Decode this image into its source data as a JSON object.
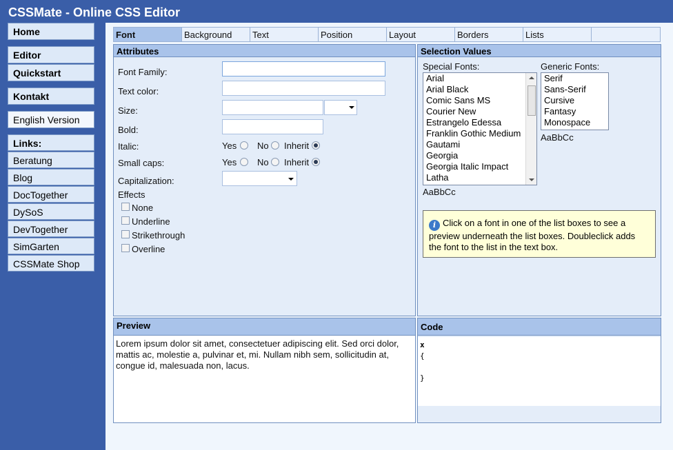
{
  "app": {
    "title": "CSSMate - Online CSS Editor"
  },
  "sidebar": {
    "items": [
      {
        "label": "Home"
      },
      {
        "label": "Editor"
      },
      {
        "label": "Quickstart"
      },
      {
        "label": "Kontakt"
      },
      {
        "label": "English Version"
      },
      {
        "label": "Links:"
      },
      {
        "label": "Beratung"
      },
      {
        "label": "Blog"
      },
      {
        "label": "DocTogether"
      },
      {
        "label": "DySoS"
      },
      {
        "label": "DevTogether"
      },
      {
        "label": "SimGarten"
      },
      {
        "label": "CSSMate Shop"
      }
    ]
  },
  "tabs": [
    {
      "label": "Font",
      "active": true
    },
    {
      "label": "Background"
    },
    {
      "label": "Text"
    },
    {
      "label": "Position"
    },
    {
      "label": "Layout"
    },
    {
      "label": "Borders"
    },
    {
      "label": "Lists"
    }
  ],
  "attributes": {
    "heading": "Attributes",
    "font_family_label": "Font Family:",
    "font_family_value": "",
    "text_color_label": "Text color:",
    "text_color_value": "",
    "size_label": "Size:",
    "size_value": "",
    "size_unit": "",
    "bold_label": "Bold:",
    "bold_value": "",
    "italic_label": "Italic:",
    "small_caps_label": "Small caps:",
    "yes_label": "Yes",
    "no_label": "No",
    "inherit_label": "Inherit",
    "italic_selected": "Inherit",
    "small_caps_selected": "Inherit",
    "capitalization_label": "Capitalization:",
    "capitalization_value": "",
    "effects_label": "Effects",
    "effects": [
      {
        "label": "None",
        "checked": false
      },
      {
        "label": "Underline",
        "checked": false
      },
      {
        "label": "Strikethrough",
        "checked": false
      },
      {
        "label": "Overline",
        "checked": false
      }
    ]
  },
  "selection": {
    "heading": "Selection Values",
    "special_fonts_label": "Special Fonts:",
    "special_fonts": [
      "Arial",
      "Arial Black",
      "Comic Sans MS",
      "Courier New",
      "Estrangelo Edessa",
      "Franklin Gothic Medium",
      "Gautami",
      "Georgia",
      "Georgia Italic Impact",
      "Latha"
    ],
    "special_preview": "AaBbCc",
    "generic_fonts_label": "Generic Fonts:",
    "generic_fonts": [
      "Serif",
      "Sans-Serif",
      "Cursive",
      "Fantasy",
      "Monospace"
    ],
    "generic_preview": "AaBbCc",
    "info_text": "Click on a font in one of the list boxes to see a preview underneath the list boxes. Doubleclick adds the font to the list in the text box."
  },
  "preview": {
    "heading": "Preview",
    "text": "Lorem ipsum dolor sit amet, consectetuer adipiscing elit. Sed orci dolor, mattis ac, molestie a, pulvinar et, mi. Nullam nibh sem, sollicitudin at, congue id, malesuada non, lacus."
  },
  "code": {
    "heading": "Code",
    "lines": [
      "x",
      "{",
      "",
      "}"
    ]
  },
  "colors": {
    "brand": "#3a5ea8",
    "panel_head": "#a9c3ea",
    "info_bg": "#ffffd9"
  }
}
